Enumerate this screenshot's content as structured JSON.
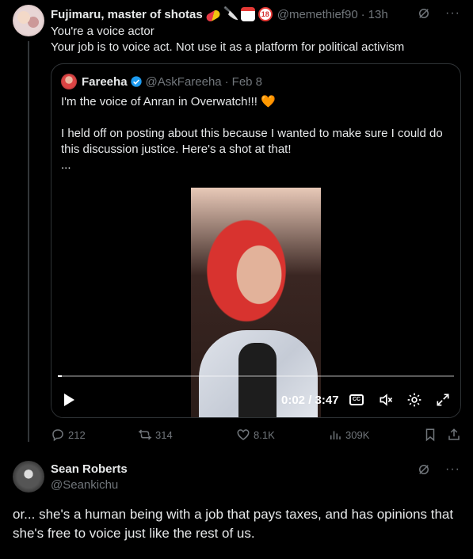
{
  "tweet1": {
    "display_name": "Fujimaru, master of shotas",
    "name_emojis": [
      "pill-emoji",
      "knife-emoji",
      "calendar-emoji",
      "18-emoji"
    ],
    "emoji_18_text": "18",
    "handle": "@memethief90",
    "separator": "·",
    "time": "13h",
    "line1": "You're a voice actor",
    "line2": "Your job is to voice act. Not use it as a platform for political activism",
    "stats": {
      "replies": "212",
      "retweets": "314",
      "likes": "8.1K",
      "views": "309K"
    }
  },
  "quote": {
    "display_name": "Fareeha",
    "handle": "@AskFareeha",
    "separator": "·",
    "date": "Feb 8",
    "line1": "I'm the voice of Anran in Overwatch!!! ",
    "heart": "🧡",
    "line2": "I held off on posting about this because I wanted to make sure I could do this discussion justice. Here's a shot at that!",
    "ellipsis": "...",
    "video": {
      "time": "0:02 / 3:47",
      "cc_label": "CC",
      "progress": 0.01
    }
  },
  "tweet2": {
    "display_name": "Sean Roberts",
    "handle": "@Seankichu",
    "body": "or... she's a human being with a job that pays taxes, and has opinions that she's free to voice just like the rest of us."
  },
  "colors": {
    "background": "#000000",
    "text": "#e7e9ea",
    "muted": "#71767b",
    "border": "#2f3336",
    "verified": "#1d9bf0"
  }
}
